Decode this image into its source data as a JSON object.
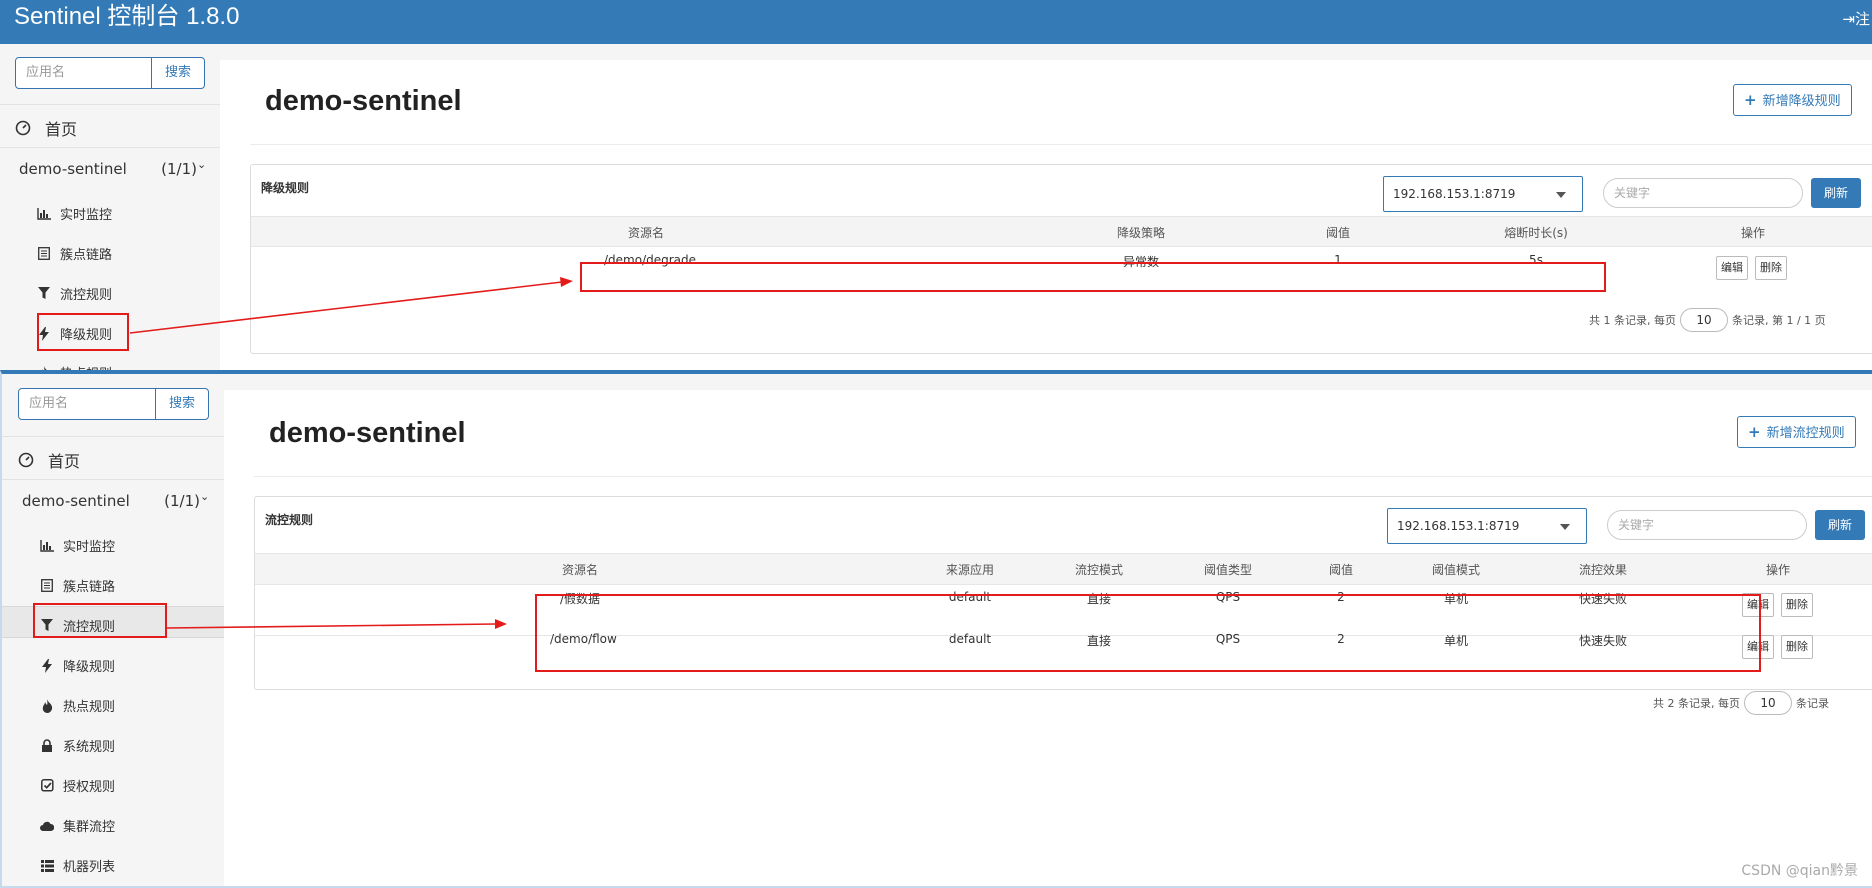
{
  "header": {
    "title": "Sentinel 控制台 1.8.0",
    "logout_label": "注"
  },
  "panel1": {
    "search": {
      "placeholder": "应用名",
      "button": "搜索"
    },
    "nav": {
      "home": "首页",
      "app": {
        "name": "demo-sentinel",
        "count": "(1/1)"
      },
      "items": [
        "实时监控",
        "簇点链路",
        "流控规则",
        "降级规则",
        "热点规则"
      ]
    },
    "title": "demo-sentinel",
    "add_button": "新增降级规则",
    "card_title": "降级规则",
    "machine": "192.168.153.1:8719",
    "keyword_placeholder": "关键字",
    "refresh": "刷新",
    "columns": [
      "资源名",
      "降级策略",
      "阈值",
      "熔断时长(s)",
      "操作"
    ],
    "rows": [
      {
        "resource": "/demo/degrade",
        "strategy": "异常数",
        "threshold": "1",
        "duration": "5s",
        "edit": "编辑",
        "delete": "删除"
      }
    ],
    "pager": {
      "prefix": "共 1 条记录, 每页",
      "page_size": "10",
      "suffix": "条记录, 第 1 / 1 页"
    }
  },
  "panel2": {
    "search": {
      "placeholder": "应用名",
      "button": "搜索"
    },
    "nav": {
      "home": "首页",
      "app": {
        "name": "demo-sentinel",
        "count": "(1/1)"
      },
      "items": [
        "实时监控",
        "簇点链路",
        "流控规则",
        "降级规则",
        "热点规则",
        "系统规则",
        "授权规则",
        "集群流控",
        "机器列表"
      ]
    },
    "title": "demo-sentinel",
    "add_button": "新增流控规则",
    "card_title": "流控规则",
    "machine": "192.168.153.1:8719",
    "keyword_placeholder": "关键字",
    "refresh": "刷新",
    "columns": [
      "资源名",
      "来源应用",
      "流控模式",
      "阈值类型",
      "阈值",
      "阈值模式",
      "流控效果",
      "操作"
    ],
    "rows": [
      {
        "resource": "/假数据",
        "origin": "default",
        "mode": "直接",
        "grade": "QPS",
        "threshold": "2",
        "threshold_mode": "单机",
        "effect": "快速失败",
        "edit": "编辑",
        "delete": "删除"
      },
      {
        "resource": "/demo/flow",
        "origin": "default",
        "mode": "直接",
        "grade": "QPS",
        "threshold": "2",
        "threshold_mode": "单机",
        "effect": "快速失败",
        "edit": "编辑",
        "delete": "删除"
      }
    ],
    "pager": {
      "prefix": "共 2 条记录, 每页",
      "page_size": "10",
      "suffix": "条记录"
    }
  },
  "watermark": "CSDN @qian黔景",
  "colors": {
    "brand": "#337ab7",
    "annotation": "#e41b1b",
    "sidebar": "#f5f5f5"
  },
  "icons": [
    "dashboard-icon",
    "bar-chart-icon",
    "list-icon",
    "filter-icon",
    "bolt-icon",
    "fire-icon",
    "lock-icon",
    "check-square-icon",
    "cloud-icon",
    "th-list-icon",
    "logout-icon",
    "plus-icon"
  ]
}
